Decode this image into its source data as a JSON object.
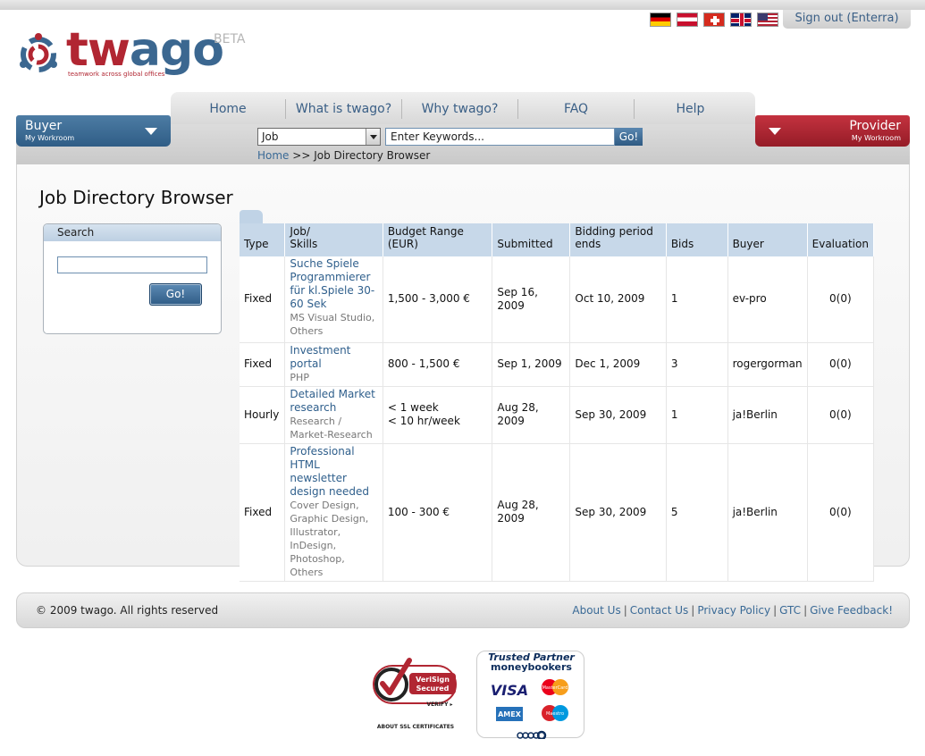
{
  "top": {
    "flags": [
      "de",
      "at",
      "ch",
      "uk",
      "us"
    ],
    "sign_out": "Sign out (Enterra)"
  },
  "logo": {
    "word_a": "tw",
    "word_b": "ago",
    "beta": "BETA",
    "tagline": "teamwork across global offices",
    "brand_red": "#b12632",
    "brand_blue": "#3b6790"
  },
  "nav": {
    "items": [
      "Home",
      "What is twago?",
      "Why twago?",
      "FAQ",
      "Help"
    ]
  },
  "buyer": {
    "title": "Buyer",
    "sub": "My Workroom"
  },
  "provider": {
    "title": "Provider",
    "sub": "My Workroom"
  },
  "search_bar": {
    "select_value": "Job",
    "keyword_placeholder": "Enter Keywords...",
    "go": "Go!"
  },
  "breadcrumb": {
    "home": "Home",
    "sep": ">>",
    "current": "Job Directory Browser"
  },
  "page": {
    "title": "Job Directory Browser"
  },
  "search_panel": {
    "title": "Search",
    "go": "Go!"
  },
  "table": {
    "headers": [
      "Type",
      "Job/\nSkills",
      "Budget Range (EUR)",
      "Submitted",
      "Bidding period ends",
      "Bids",
      "Buyer",
      "Evaluation"
    ],
    "rows": [
      {
        "type": "Fixed",
        "job": "Suche Spiele Programmierer für kl.Spiele 30-60 Sek",
        "skills": "MS Visual Studio, Others",
        "budget": "1,500 - 3,000 €",
        "submitted": "Sep 16, 2009",
        "ends": "Oct 10, 2009",
        "bids": "1",
        "buyer": "ev-pro",
        "evaluation": "0(0)"
      },
      {
        "type": "Fixed",
        "job": "Investment portal",
        "skills": "PHP",
        "budget": "800 - 1,500 €",
        "submitted": "Sep 1, 2009",
        "ends": "Dec 1, 2009",
        "bids": "3",
        "buyer": "rogergorman",
        "evaluation": "0(0)"
      },
      {
        "type": "Hourly",
        "job": "Detailed Market research",
        "skills": "Research / Market-Research",
        "budget": "< 1 week\n< 10 hr/week",
        "submitted": "Aug 28, 2009",
        "ends": "Sep 30, 2009",
        "bids": "1",
        "buyer": "ja!Berlin",
        "evaluation": "0(0)"
      },
      {
        "type": "Fixed",
        "job": "Professional HTML newsletter design needed",
        "skills": "Cover Design, Graphic Design, Illustrator, InDesign, Photoshop, Others",
        "budget": "100 - 300 €",
        "submitted": "Aug 28, 2009",
        "ends": "Sep 30, 2009",
        "bids": "5",
        "buyer": "ja!Berlin",
        "evaluation": "0(0)"
      }
    ]
  },
  "footer": {
    "copyright": "© 2009 twago. All rights reserved",
    "links": [
      "About Us",
      "Contact Us",
      "Privacy Policy",
      "GTC",
      "Give Feedback!"
    ]
  },
  "badges": {
    "verisign_l1": "VeriSign",
    "verisign_l2": "Secured",
    "verisign_verify": "VERIFY ▸",
    "ssl": "ABOUT SSL CERTIFICATES",
    "mb_l1": "Trusted Partner",
    "mb_l2": "moneybookers",
    "visa": "VISA",
    "mastercard": "MasterCard",
    "amex": "AMEX",
    "maestro": "Maestro"
  }
}
